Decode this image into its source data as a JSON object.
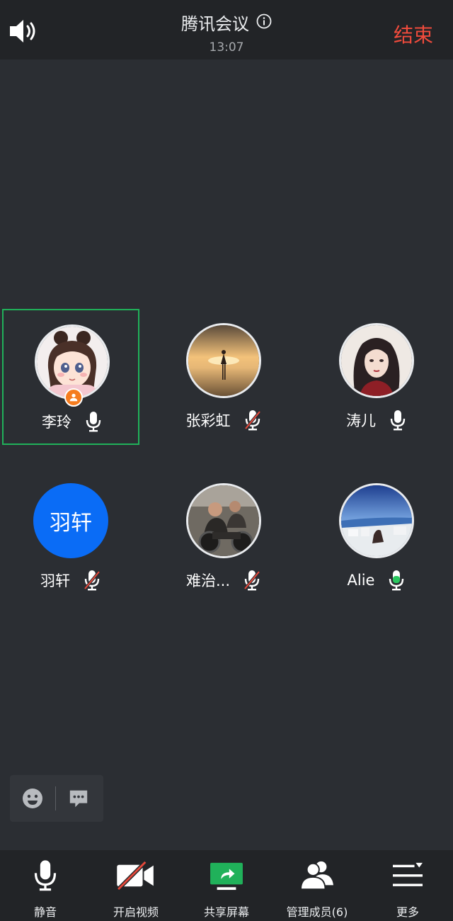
{
  "header": {
    "title": "腾讯会议",
    "time": "13:07",
    "end_label": "结束"
  },
  "participants": [
    {
      "name": "李玲",
      "mic": "on",
      "host": true,
      "active": true,
      "avatar": "photo"
    },
    {
      "name": "张彩虹",
      "mic": "muted",
      "avatar": "photo"
    },
    {
      "name": "涛儿",
      "mic": "on",
      "avatar": "photo"
    },
    {
      "name": "羽轩",
      "mic": "muted",
      "avatar": "text",
      "avatar_text": "羽轩"
    },
    {
      "name": "难治...",
      "mic": "muted",
      "avatar": "photo"
    },
    {
      "name": "Alie",
      "mic": "speaking",
      "avatar": "photo"
    }
  ],
  "toolbar": {
    "mute_label": "静音",
    "video_label": "开启视频",
    "share_label": "共享屏幕",
    "members_label": "管理成员(6)",
    "more_label": "更多"
  },
  "colors": {
    "end": "#f04b3c",
    "active_border": "#20b15a",
    "host_badge": "#f57c1f",
    "text_avatar": "#0a6cf6",
    "speaking_mic": "#29c75f",
    "share_icon": "#20b15a",
    "muted_slash": "#e5483a"
  }
}
